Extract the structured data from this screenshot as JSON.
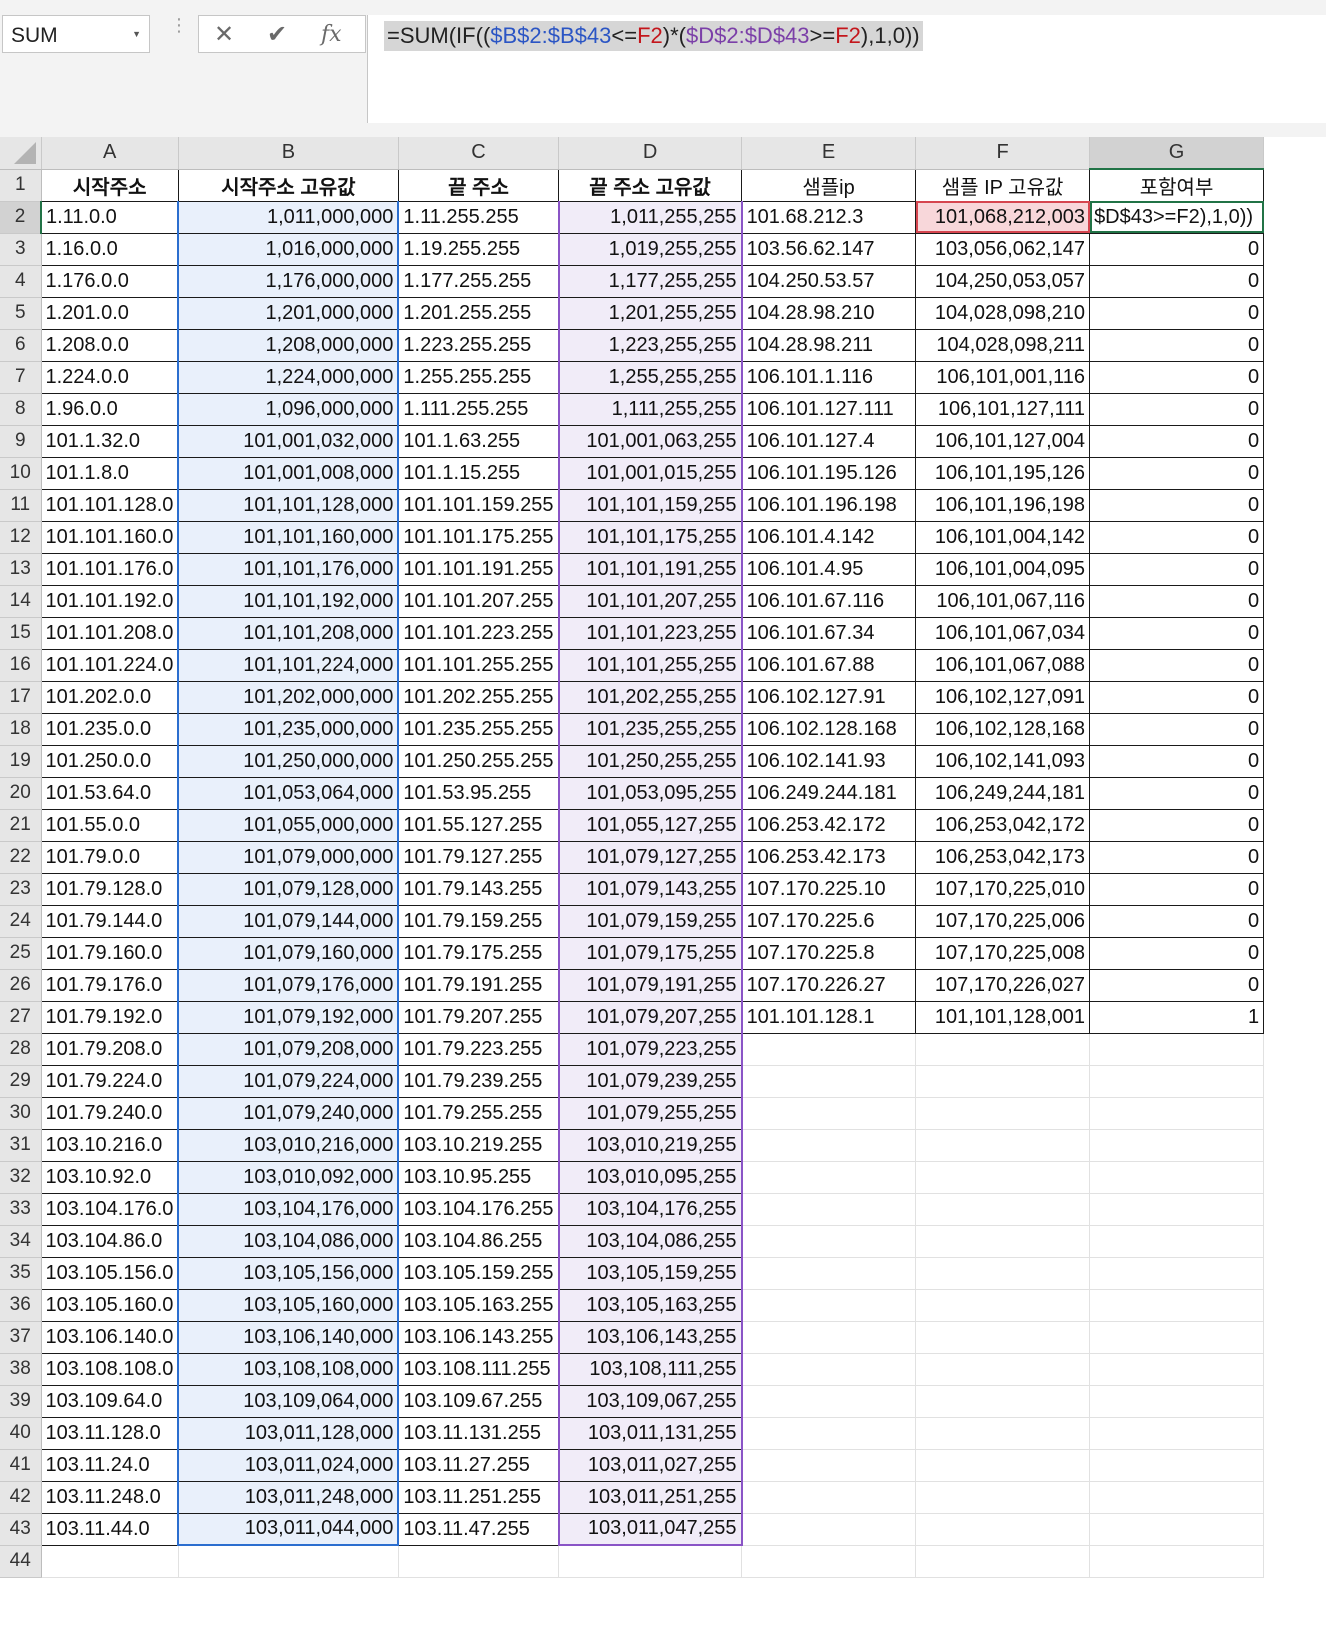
{
  "formula_bar": {
    "name_box": "SUM",
    "cancel_icon": "close-icon",
    "enter_icon": "check-icon",
    "fx_label": "fx",
    "formula_parts": [
      "=SUM(IF((",
      "$B$2:$B$43",
      "<=",
      "F2",
      ")*(",
      "$D$2:$D$43",
      ">=",
      "F2",
      "),1,0))"
    ]
  },
  "columns": [
    "A",
    "B",
    "C",
    "D",
    "E",
    "F",
    "G"
  ],
  "header_row": [
    "시작주소",
    "시작주소 고유값",
    "끝 주소",
    "끝 주소 고유값",
    "샘플ip",
    "샘플 IP 고유값",
    "포함여부"
  ],
  "active_cell_text": "$D$43>=F2),1,0))",
  "rows": [
    {
      "n": 2,
      "a": "1.11.0.0",
      "b": "1,011,000,000",
      "c": "1.11.255.255",
      "d": "1,011,255,255",
      "e": "101.68.212.3",
      "f": "101,068,212,003",
      "g": ""
    },
    {
      "n": 3,
      "a": "1.16.0.0",
      "b": "1,016,000,000",
      "c": "1.19.255.255",
      "d": "1,019,255,255",
      "e": "103.56.62.147",
      "f": "103,056,062,147",
      "g": "0"
    },
    {
      "n": 4,
      "a": "1.176.0.0",
      "b": "1,176,000,000",
      "c": "1.177.255.255",
      "d": "1,177,255,255",
      "e": "104.250.53.57",
      "f": "104,250,053,057",
      "g": "0"
    },
    {
      "n": 5,
      "a": "1.201.0.0",
      "b": "1,201,000,000",
      "c": "1.201.255.255",
      "d": "1,201,255,255",
      "e": "104.28.98.210",
      "f": "104,028,098,210",
      "g": "0"
    },
    {
      "n": 6,
      "a": "1.208.0.0",
      "b": "1,208,000,000",
      "c": "1.223.255.255",
      "d": "1,223,255,255",
      "e": "104.28.98.211",
      "f": "104,028,098,211",
      "g": "0"
    },
    {
      "n": 7,
      "a": "1.224.0.0",
      "b": "1,224,000,000",
      "c": "1.255.255.255",
      "d": "1,255,255,255",
      "e": "106.101.1.116",
      "f": "106,101,001,116",
      "g": "0"
    },
    {
      "n": 8,
      "a": "1.96.0.0",
      "b": "1,096,000,000",
      "c": "1.111.255.255",
      "d": "1,111,255,255",
      "e": "106.101.127.111",
      "f": "106,101,127,111",
      "g": "0"
    },
    {
      "n": 9,
      "a": "101.1.32.0",
      "b": "101,001,032,000",
      "c": "101.1.63.255",
      "d": "101,001,063,255",
      "e": "106.101.127.4",
      "f": "106,101,127,004",
      "g": "0"
    },
    {
      "n": 10,
      "a": "101.1.8.0",
      "b": "101,001,008,000",
      "c": "101.1.15.255",
      "d": "101,001,015,255",
      "e": "106.101.195.126",
      "f": "106,101,195,126",
      "g": "0"
    },
    {
      "n": 11,
      "a": "101.101.128.0",
      "b": "101,101,128,000",
      "c": "101.101.159.255",
      "d": "101,101,159,255",
      "e": "106.101.196.198",
      "f": "106,101,196,198",
      "g": "0"
    },
    {
      "n": 12,
      "a": "101.101.160.0",
      "b": "101,101,160,000",
      "c": "101.101.175.255",
      "d": "101,101,175,255",
      "e": "106.101.4.142",
      "f": "106,101,004,142",
      "g": "0"
    },
    {
      "n": 13,
      "a": "101.101.176.0",
      "b": "101,101,176,000",
      "c": "101.101.191.255",
      "d": "101,101,191,255",
      "e": "106.101.4.95",
      "f": "106,101,004,095",
      "g": "0"
    },
    {
      "n": 14,
      "a": "101.101.192.0",
      "b": "101,101,192,000",
      "c": "101.101.207.255",
      "d": "101,101,207,255",
      "e": "106.101.67.116",
      "f": "106,101,067,116",
      "g": "0"
    },
    {
      "n": 15,
      "a": "101.101.208.0",
      "b": "101,101,208,000",
      "c": "101.101.223.255",
      "d": "101,101,223,255",
      "e": "106.101.67.34",
      "f": "106,101,067,034",
      "g": "0"
    },
    {
      "n": 16,
      "a": "101.101.224.0",
      "b": "101,101,224,000",
      "c": "101.101.255.255",
      "d": "101,101,255,255",
      "e": "106.101.67.88",
      "f": "106,101,067,088",
      "g": "0"
    },
    {
      "n": 17,
      "a": "101.202.0.0",
      "b": "101,202,000,000",
      "c": "101.202.255.255",
      "d": "101,202,255,255",
      "e": "106.102.127.91",
      "f": "106,102,127,091",
      "g": "0"
    },
    {
      "n": 18,
      "a": "101.235.0.0",
      "b": "101,235,000,000",
      "c": "101.235.255.255",
      "d": "101,235,255,255",
      "e": "106.102.128.168",
      "f": "106,102,128,168",
      "g": "0"
    },
    {
      "n": 19,
      "a": "101.250.0.0",
      "b": "101,250,000,000",
      "c": "101.250.255.255",
      "d": "101,250,255,255",
      "e": "106.102.141.93",
      "f": "106,102,141,093",
      "g": "0"
    },
    {
      "n": 20,
      "a": "101.53.64.0",
      "b": "101,053,064,000",
      "c": "101.53.95.255",
      "d": "101,053,095,255",
      "e": "106.249.244.181",
      "f": "106,249,244,181",
      "g": "0"
    },
    {
      "n": 21,
      "a": "101.55.0.0",
      "b": "101,055,000,000",
      "c": "101.55.127.255",
      "d": "101,055,127,255",
      "e": "106.253.42.172",
      "f": "106,253,042,172",
      "g": "0"
    },
    {
      "n": 22,
      "a": "101.79.0.0",
      "b": "101,079,000,000",
      "c": "101.79.127.255",
      "d": "101,079,127,255",
      "e": "106.253.42.173",
      "f": "106,253,042,173",
      "g": "0"
    },
    {
      "n": 23,
      "a": "101.79.128.0",
      "b": "101,079,128,000",
      "c": "101.79.143.255",
      "d": "101,079,143,255",
      "e": "107.170.225.10",
      "f": "107,170,225,010",
      "g": "0"
    },
    {
      "n": 24,
      "a": "101.79.144.0",
      "b": "101,079,144,000",
      "c": "101.79.159.255",
      "d": "101,079,159,255",
      "e": "107.170.225.6",
      "f": "107,170,225,006",
      "g": "0"
    },
    {
      "n": 25,
      "a": "101.79.160.0",
      "b": "101,079,160,000",
      "c": "101.79.175.255",
      "d": "101,079,175,255",
      "e": "107.170.225.8",
      "f": "107,170,225,008",
      "g": "0"
    },
    {
      "n": 26,
      "a": "101.79.176.0",
      "b": "101,079,176,000",
      "c": "101.79.191.255",
      "d": "101,079,191,255",
      "e": "107.170.226.27",
      "f": "107,170,226,027",
      "g": "0"
    },
    {
      "n": 27,
      "a": "101.79.192.0",
      "b": "101,079,192,000",
      "c": "101.79.207.255",
      "d": "101,079,207,255",
      "e": "101.101.128.1",
      "f": "101,101,128,001",
      "g": "1"
    },
    {
      "n": 28,
      "a": "101.79.208.0",
      "b": "101,079,208,000",
      "c": "101.79.223.255",
      "d": "101,079,223,255"
    },
    {
      "n": 29,
      "a": "101.79.224.0",
      "b": "101,079,224,000",
      "c": "101.79.239.255",
      "d": "101,079,239,255"
    },
    {
      "n": 30,
      "a": "101.79.240.0",
      "b": "101,079,240,000",
      "c": "101.79.255.255",
      "d": "101,079,255,255"
    },
    {
      "n": 31,
      "a": "103.10.216.0",
      "b": "103,010,216,000",
      "c": "103.10.219.255",
      "d": "103,010,219,255"
    },
    {
      "n": 32,
      "a": "103.10.92.0",
      "b": "103,010,092,000",
      "c": "103.10.95.255",
      "d": "103,010,095,255"
    },
    {
      "n": 33,
      "a": "103.104.176.0",
      "b": "103,104,176,000",
      "c": "103.104.176.255",
      "d": "103,104,176,255"
    },
    {
      "n": 34,
      "a": "103.104.86.0",
      "b": "103,104,086,000",
      "c": "103.104.86.255",
      "d": "103,104,086,255"
    },
    {
      "n": 35,
      "a": "103.105.156.0",
      "b": "103,105,156,000",
      "c": "103.105.159.255",
      "d": "103,105,159,255"
    },
    {
      "n": 36,
      "a": "103.105.160.0",
      "b": "103,105,160,000",
      "c": "103.105.163.255",
      "d": "103,105,163,255"
    },
    {
      "n": 37,
      "a": "103.106.140.0",
      "b": "103,106,140,000",
      "c": "103.106.143.255",
      "d": "103,106,143,255"
    },
    {
      "n": 38,
      "a": "103.108.108.0",
      "b": "103,108,108,000",
      "c": "103.108.111.255",
      "d": "103,108,111,255"
    },
    {
      "n": 39,
      "a": "103.109.64.0",
      "b": "103,109,064,000",
      "c": "103.109.67.255",
      "d": "103,109,067,255"
    },
    {
      "n": 40,
      "a": "103.11.128.0",
      "b": "103,011,128,000",
      "c": "103.11.131.255",
      "d": "103,011,131,255"
    },
    {
      "n": 41,
      "a": "103.11.24.0",
      "b": "103,011,024,000",
      "c": "103.11.27.255",
      "d": "103,011,027,255"
    },
    {
      "n": 42,
      "a": "103.11.248.0",
      "b": "103,011,248,000",
      "c": "103.11.251.255",
      "d": "103,011,251,255"
    },
    {
      "n": 43,
      "a": "103.11.44.0",
      "b": "103,011,044,000",
      "c": "103.11.47.255",
      "d": "103,011,047,255"
    },
    {
      "n": 44
    }
  ]
}
